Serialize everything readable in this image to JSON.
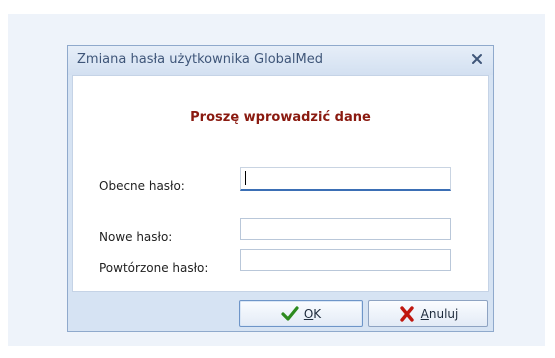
{
  "dialog": {
    "title": "Zmiana hasła użytkownika GlobalMed",
    "close_icon": "close-icon",
    "heading": "Proszę wprowadzić dane",
    "fields": [
      {
        "label": "Obecne hasło:",
        "value": ""
      },
      {
        "label": "Nowe hasło:",
        "value": ""
      },
      {
        "label": "Powtórzone hasło:",
        "value": ""
      }
    ],
    "buttons": {
      "ok_mnemonic": "O",
      "ok_rest": "K",
      "cancel_mnemonic": "A",
      "cancel_rest": "nuluj"
    }
  },
  "colors": {
    "heading": "#8a1a10",
    "ok_check": "#2e8b1f",
    "cancel_x": "#c0170f",
    "title_text": "#3f5679"
  }
}
